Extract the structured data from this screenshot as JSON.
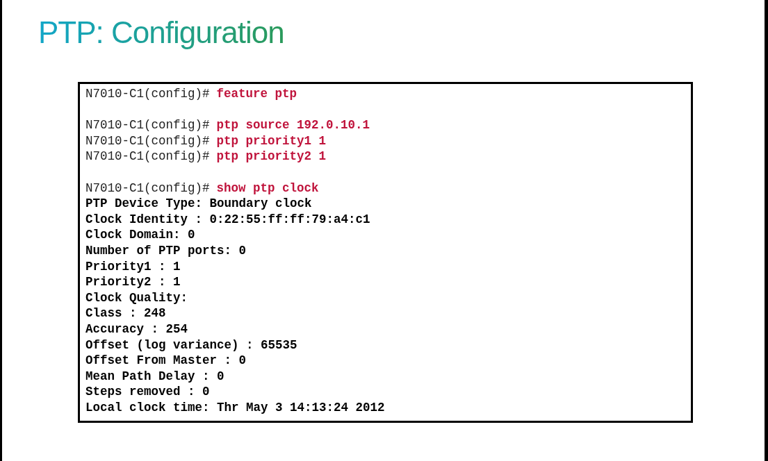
{
  "title": "PTP: Configuration",
  "terminal": {
    "blocks": [
      {
        "lines": [
          {
            "kind": "command",
            "prompt": "N7010-C1(config)#",
            "command": "feature ptp"
          }
        ]
      },
      {
        "lines": [
          {
            "kind": "command",
            "prompt": "N7010-C1(config)#",
            "command": "ptp source 192.0.10.1"
          },
          {
            "kind": "command",
            "prompt": "N7010-C1(config)#",
            "command": "ptp priority1 1"
          },
          {
            "kind": "command",
            "prompt": "N7010-C1(config)#",
            "command": "ptp priority2 1"
          }
        ]
      },
      {
        "lines": [
          {
            "kind": "command",
            "prompt": "N7010-C1(config)#",
            "command": "show ptp clock"
          },
          {
            "kind": "output",
            "text": "PTP Device Type: Boundary clock"
          },
          {
            "kind": "output",
            "text": "Clock Identity : 0:22:55:ff:ff:79:a4:c1"
          },
          {
            "kind": "output",
            "text": "Clock Domain: 0"
          },
          {
            "kind": "output",
            "text": "Number of PTP ports: 0"
          },
          {
            "kind": "output",
            "text": "Priority1 : 1"
          },
          {
            "kind": "output",
            "text": "Priority2 : 1"
          },
          {
            "kind": "output",
            "text": "Clock Quality:"
          },
          {
            "kind": "output",
            "text": "Class : 248"
          },
          {
            "kind": "output",
            "text": "Accuracy : 254"
          },
          {
            "kind": "output",
            "text": "Offset (log variance) : 65535"
          },
          {
            "kind": "output",
            "text": "Offset From Master : 0"
          },
          {
            "kind": "output",
            "text": "Mean Path Delay : 0"
          },
          {
            "kind": "output",
            "text": "Steps removed : 0"
          },
          {
            "kind": "output",
            "text": "Local clock time: Thr May 3 14:13:24 2012"
          }
        ]
      }
    ]
  }
}
